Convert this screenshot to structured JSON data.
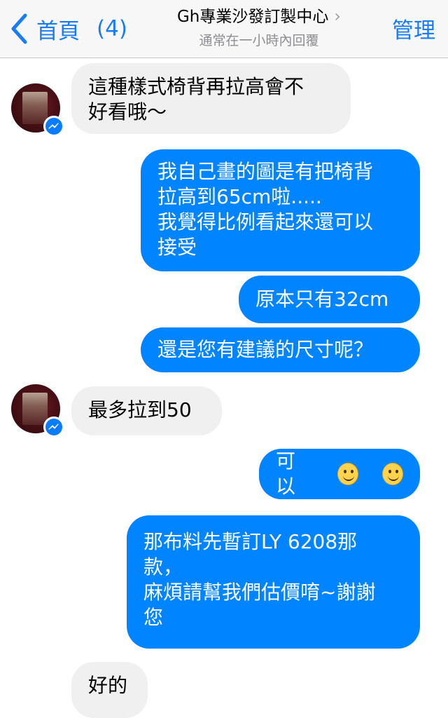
{
  "header": {
    "back_label": "首頁",
    "back_count": "(4)",
    "title": "Gh專業沙發訂製中心",
    "subtitle": "通常在一小時內回覆",
    "manage_label": "管理"
  },
  "messages": [
    {
      "side": "in",
      "text": "這種樣式椅背再拉高會不\n好看哦～"
    },
    {
      "side": "out",
      "text": "我自己畫的圖是有把椅背\n拉高到65cm啦.....\n我覺得比例看起來還可以\n接受"
    },
    {
      "side": "out",
      "text": "原本只有32cm"
    },
    {
      "side": "out",
      "text": "還是您有建議的尺寸呢？"
    },
    {
      "side": "in",
      "text": "最多拉到50"
    },
    {
      "side": "out",
      "text": "可以"
    },
    {
      "side": "out",
      "text": "那布料先暫訂LY 6208那\n款，\n麻煩請幫我們估價唷~謝謝\n您"
    },
    {
      "side": "in",
      "text": "好的"
    }
  ],
  "colors": {
    "accent": "#1a7cf2",
    "outgoing_bubble": "#0084ff",
    "incoming_bubble": "#f0f0f0"
  },
  "icons": [
    "chevron-left-icon",
    "chevron-right-icon",
    "messenger-badge-icon",
    "smiley-emoji-icon"
  ]
}
